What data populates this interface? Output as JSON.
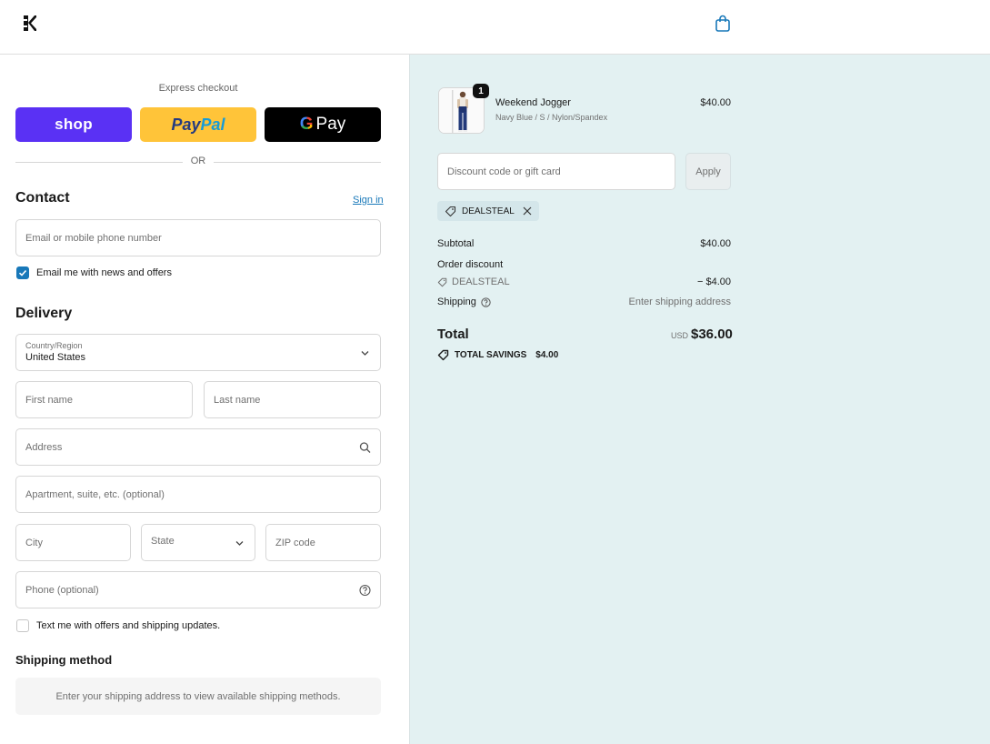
{
  "header": {
    "logo_alt": "K",
    "cart_icon": "shopping-bag-icon"
  },
  "express": {
    "label": "Express checkout",
    "shop_label": "shop",
    "paypal_part1": "Pay",
    "paypal_part2": "Pal",
    "gpay_g": "G",
    "gpay_label": "Pay",
    "or_label": "OR"
  },
  "contact": {
    "title": "Contact",
    "signin_label": "Sign in",
    "email_placeholder": "Email or mobile phone number",
    "newsletter_label": "Email me with news and offers",
    "newsletter_checked": true
  },
  "delivery": {
    "title": "Delivery",
    "country_label": "Country/Region",
    "country_value": "United States",
    "first_name_placeholder": "First name",
    "last_name_placeholder": "Last name",
    "address_placeholder": "Address",
    "apartment_placeholder": "Apartment, suite, etc. (optional)",
    "city_placeholder": "City",
    "state_placeholder": "State",
    "zip_placeholder": "ZIP code",
    "phone_placeholder": "Phone (optional)",
    "sms_label": "Text me with offers and shipping updates.",
    "sms_checked": false
  },
  "shipping_method": {
    "title": "Shipping method",
    "message": "Enter your shipping address to view available shipping methods."
  },
  "order": {
    "item": {
      "quantity": "1",
      "name": "Weekend Jogger",
      "variant": "Navy Blue / S / Nylon/Spandex",
      "price": "$40.00"
    },
    "discount_placeholder": "Discount code or gift card",
    "apply_label": "Apply",
    "applied_code": "DEALSTEAL",
    "subtotal_label": "Subtotal",
    "subtotal_value": "$40.00",
    "order_discount_label": "Order discount",
    "discount_code": "DEALSTEAL",
    "discount_value": "− $4.00",
    "shipping_label": "Shipping",
    "shipping_value": "Enter shipping address",
    "total_label": "Total",
    "total_currency": "USD",
    "total_value": "$36.00",
    "savings_label": "TOTAL SAVINGS",
    "savings_value": "$4.00"
  },
  "colors": {
    "accent": "#1878b9",
    "shop": "#5a31f4",
    "paypal": "#ffc439",
    "summary_bg": "#e3f1f2"
  }
}
